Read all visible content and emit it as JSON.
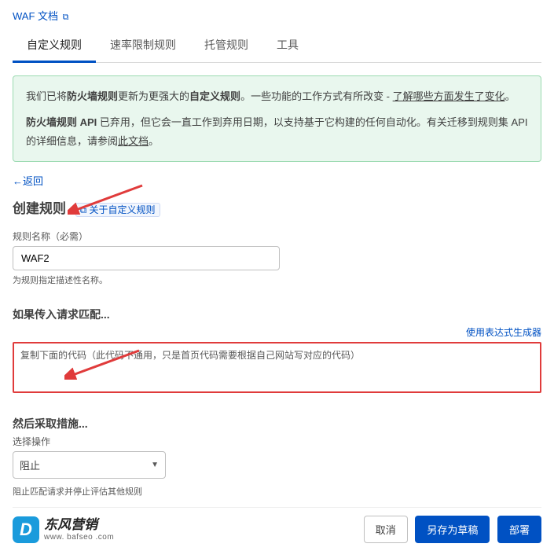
{
  "topLink": "WAF 文档",
  "tabs": [
    "自定义规则",
    "速率限制规则",
    "托管规则",
    "工具"
  ],
  "alert": {
    "p1a": "我们已将",
    "p1b": "防火墙规则",
    "p1c": "更新为更强大的",
    "p1d": "自定义规则",
    "p1e": "。一些功能的工作方式有所改变 - ",
    "p1link": "了解哪些方面发生了变化",
    "p1f": "。",
    "p2a": "防火墙规则 API",
    "p2b": " 已弃用，但它会一直工作到弃用日期，以支持基于它构建的任何自动化。有关迁移到规则集 API 的详细信息，请参阅",
    "p2link": "此文档",
    "p2c": "。"
  },
  "back": "←返回",
  "title": "创建规则",
  "titleTag": "⧉ 关于自定义规则",
  "ruleName": {
    "label": "规则名称（必需）",
    "value": "WAF2",
    "help": "为规则指定描述性名称。"
  },
  "incoming": {
    "title": "如果传入请求匹配...",
    "exprLink": "使用表达式生成器",
    "codePlaceholder": "复制下面的代码（此代码不通用，只是首页代码需要根据自己网站写对应的代码）"
  },
  "action": {
    "title": "然后采取措施...",
    "label": "选择操作",
    "value": "阻止",
    "note": "阻止匹配请求并停止评估其他规则"
  },
  "buttons": {
    "cancel": "取消",
    "draft": "另存为草稿",
    "deploy": "部署"
  },
  "watermark": {
    "zh": "东风营销",
    "en": "www. bafseo .com"
  }
}
